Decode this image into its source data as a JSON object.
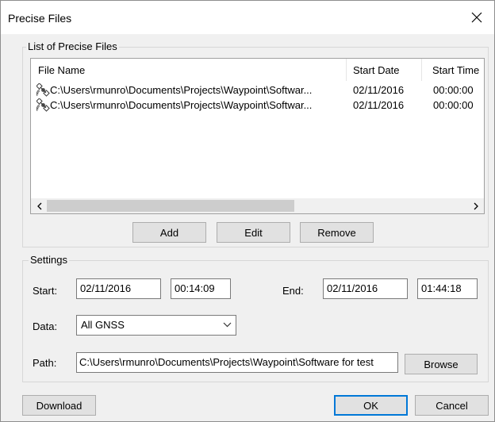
{
  "window": {
    "title": "Precise Files"
  },
  "files_group": {
    "label": "List of Precise Files",
    "columns": [
      "File Name",
      "Start Date",
      "Start Time"
    ],
    "rows": [
      {
        "file": "C:\\Users\\rmunro\\Documents\\Projects\\Waypoint\\Softwar...",
        "date": "02/11/2016",
        "time": "00:00:00"
      },
      {
        "file": "C:\\Users\\rmunro\\Documents\\Projects\\Waypoint\\Softwar...",
        "date": "02/11/2016",
        "time": "00:00:00"
      }
    ],
    "row_icon": "satellite-icon",
    "buttons": {
      "add": "Add",
      "edit": "Edit",
      "remove": "Remove"
    }
  },
  "settings": {
    "label": "Settings",
    "start_label": "Start:",
    "start_date": "02/11/2016",
    "start_time": "00:14:09",
    "end_label": "End:",
    "end_date": "02/11/2016",
    "end_time": "01:44:18",
    "data_label": "Data:",
    "data_value": "All GNSS",
    "path_label": "Path:",
    "path_value": "C:\\Users\\rmunro\\Documents\\Projects\\Waypoint\\Software for test",
    "browse": "Browse"
  },
  "footer": {
    "download": "Download",
    "ok": "OK",
    "cancel": "Cancel"
  },
  "colors": {
    "accent": "#0078d7",
    "dialog_bg": "#f0f0f0"
  }
}
